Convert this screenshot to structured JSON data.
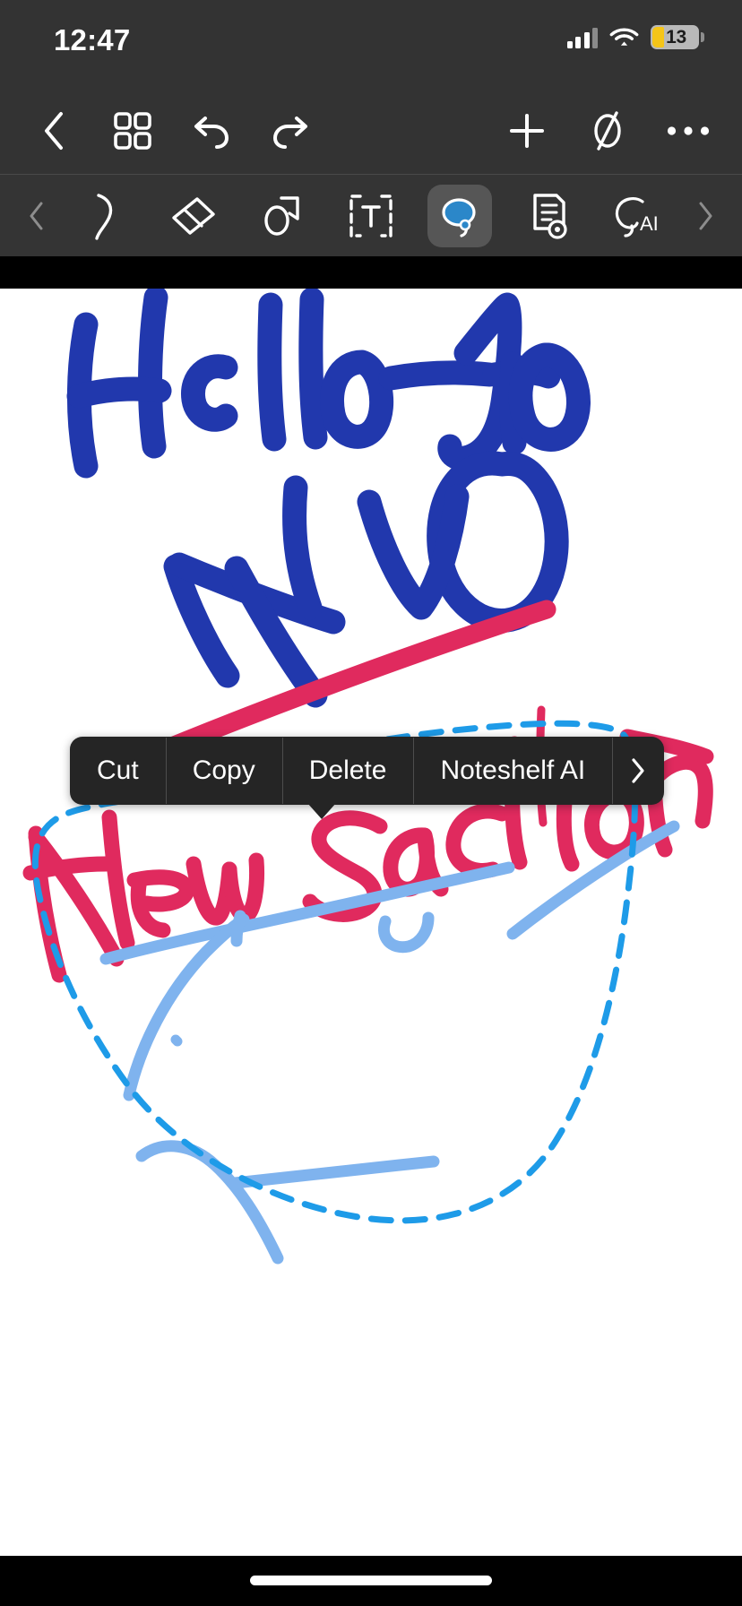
{
  "status_bar": {
    "time": "12:47",
    "battery_level": "13",
    "battery_fill_color": "#f5c518",
    "signal_icon": "cellular-signal-icon",
    "wifi_icon": "wifi-icon",
    "battery_icon": "battery-icon"
  },
  "nav_bar": {
    "left": [
      {
        "name": "back-button",
        "icon": "chevron-left-icon"
      },
      {
        "name": "page-grid-button",
        "icon": "grid-squares-icon"
      },
      {
        "name": "undo-button",
        "icon": "undo-arrow-icon"
      },
      {
        "name": "redo-button",
        "icon": "redo-arrow-icon"
      }
    ],
    "right": [
      {
        "name": "add-button",
        "icon": "plus-icon"
      },
      {
        "name": "no-fill-button",
        "icon": "circle-slash-icon"
      },
      {
        "name": "more-options-button",
        "icon": "ellipsis-icon"
      }
    ]
  },
  "tool_bar": {
    "scroll_left_icon": "chevron-left-icon",
    "scroll_right_icon": "chevron-right-icon",
    "selected_tool": "lasso-select-tool",
    "tools": [
      {
        "name": "pen-tool",
        "icon": "pen-nib-icon",
        "selected": false
      },
      {
        "name": "eraser-tool",
        "icon": "eraser-icon",
        "selected": false
      },
      {
        "name": "shape-tool",
        "icon": "shapes-icon",
        "selected": false
      },
      {
        "name": "text-tool",
        "icon": "text-box-icon",
        "selected": false
      },
      {
        "name": "lasso-select-tool",
        "icon": "lasso-icon",
        "selected": true
      },
      {
        "name": "note-tool",
        "icon": "document-lines-icon",
        "selected": false
      },
      {
        "name": "ai-tool",
        "icon": "lasso-ai-icon",
        "selected": false
      }
    ]
  },
  "context_menu": {
    "items": [
      {
        "name": "cut-menu-item",
        "label": "Cut"
      },
      {
        "name": "copy-menu-item",
        "label": "Copy"
      },
      {
        "name": "delete-menu-item",
        "label": "Delete"
      },
      {
        "name": "noteshelf-ai-menu-item",
        "label": "Noteshelf AI"
      }
    ],
    "more_icon": "chevron-right-icon"
  },
  "canvas": {
    "background_color": "#ffffff",
    "ink_colors": {
      "dark_blue": "#2138ad",
      "crimson": "#e02a5e",
      "light_blue": "#7fb3ee",
      "lasso_dashed": "#1e9be8"
    },
    "handwriting": [
      {
        "name": "handwriting-hello",
        "text": "Hello",
        "color": "#2138ad"
      },
      {
        "name": "handwriting-new-section",
        "text": "New Section",
        "color": "#e02a5e"
      }
    ],
    "selection": {
      "name": "lasso-selection-outline",
      "style": "dashed",
      "color": "#1e9be8"
    }
  },
  "home_indicator": {
    "name": "home-indicator"
  }
}
